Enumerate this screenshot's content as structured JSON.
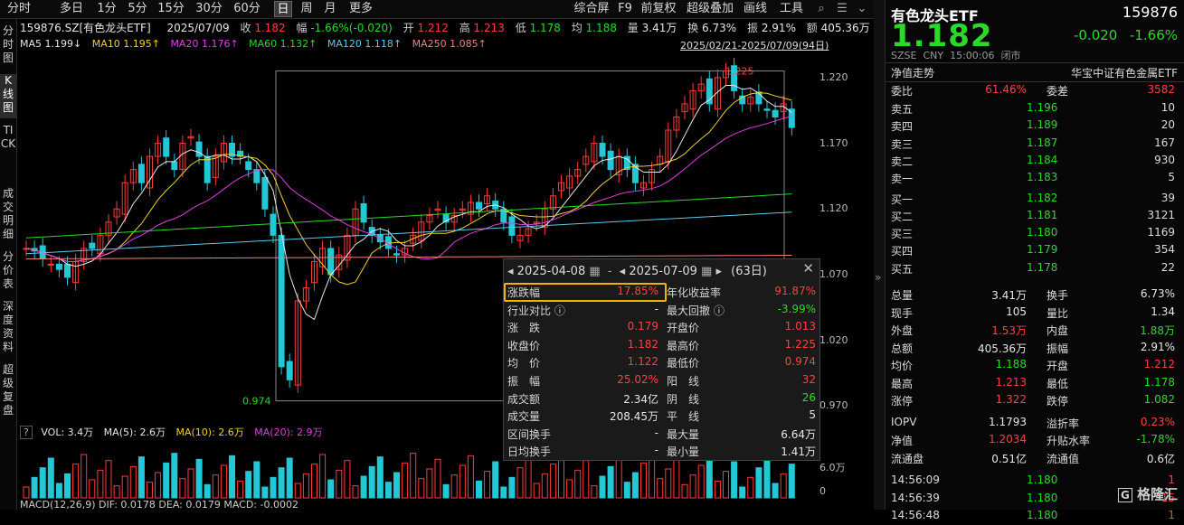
{
  "toolbar": {
    "periods": [
      "分时",
      "多日",
      "1分",
      "5分",
      "15分",
      "30分",
      "60分",
      "日",
      "周",
      "月",
      "更多"
    ],
    "active_period": "日",
    "tools": [
      "综合屏",
      "F9",
      "前复权",
      "超级叠加",
      "画线",
      "工具"
    ]
  },
  "sidenav": [
    "分时图",
    "K线图",
    "TICK",
    "成交明细",
    "分价表",
    "深度资料",
    "超级复盘"
  ],
  "sidenav_active": "K线图",
  "info": {
    "code": "159876.SZ[有色龙头ETF]",
    "date": "2025/07/09",
    "close_label": "收",
    "close": "1.182",
    "change_label": "幅",
    "change": "-1.66%(-0.020)",
    "open_label": "开",
    "open": "1.212",
    "high_label": "高",
    "high": "1.213",
    "low_label": "低",
    "low": "1.178",
    "avg_label": "均",
    "avg": "1.188",
    "vol_label": "量",
    "vol": "3.41万",
    "turnover_label": "换",
    "turnover": "6.73%",
    "amp_label": "振",
    "amp": "2.91%",
    "amount_label": "额",
    "amount": "405.36万"
  },
  "ma": {
    "ma5": "MA5 1.199↓",
    "ma10": "MA10 1.195↑",
    "ma20": "MA20 1.176↑",
    "ma60": "MA60 1.132↑",
    "ma120": "MA120 1.118↑",
    "ma250": "MA250 1.085↑",
    "range": "2025/02/21-2025/07/09(94日)"
  },
  "chart": {
    "yticks": [
      "1.220",
      "1.170",
      "1.120",
      "1.070",
      "1.020",
      "0.970"
    ],
    "high_mark": "1.225",
    "low_mark": "0.974",
    "vol_ticks": [
      "6.0万",
      "0"
    ]
  },
  "volume_bar": {
    "label": "VOL: 3.4万",
    "ma5": "MA(5): 2.6万",
    "ma10": "MA(10): 2.6万",
    "ma20": "MA(20): 2.9万"
  },
  "macd_bar": "MACD(12,26,9) DIF: 0.0178 DEA: 0.0179 MACD: -0.0002",
  "popup": {
    "start": "2025-04-08",
    "end": "2025-07-09",
    "days": "(63日)",
    "rows": [
      {
        "l": "涨跌幅",
        "v": "17.85%",
        "vc": "red",
        "l2": "年化收益率",
        "v2": "91.87%",
        "v2c": "red"
      },
      {
        "l": "行业对比 ⓘ",
        "v": "-",
        "vc": "white",
        "l2": "最大回撤 ⓘ",
        "v2": "-3.99%",
        "v2c": "green"
      },
      {
        "l": "涨　跌",
        "v": "0.179",
        "vc": "red",
        "l2": "开盘价",
        "v2": "1.013",
        "v2c": "red"
      },
      {
        "l": "收盘价",
        "v": "1.182",
        "vc": "red",
        "l2": "最高价",
        "v2": "1.225",
        "v2c": "red"
      },
      {
        "l": "均　价",
        "v": "1.122",
        "vc": "red",
        "l2": "最低价",
        "v2": "0.974",
        "v2c": "red"
      },
      {
        "l": "振　幅",
        "v": "25.02%",
        "vc": "red",
        "l2": "阳　线",
        "v2": "32",
        "v2c": "red"
      },
      {
        "l": "成交额",
        "v": "2.34亿",
        "vc": "white",
        "l2": "阴　线",
        "v2": "26",
        "v2c": "green"
      },
      {
        "l": "成交量",
        "v": "208.45万",
        "vc": "white",
        "l2": "平　线",
        "v2": "5",
        "v2c": "white"
      },
      {
        "l": "区间换手",
        "v": "-",
        "vc": "white",
        "l2": "最大量",
        "v2": "6.64万",
        "v2c": "white"
      },
      {
        "l": "日均换手",
        "v": "-",
        "vc": "white",
        "l2": "最小量",
        "v2": "1.41万",
        "v2c": "white"
      }
    ]
  },
  "quote": {
    "name": "有色龙头ETF",
    "code": "159876",
    "price": "1.182",
    "change": "-0.020",
    "pct": "-1.66%",
    "sub": "SZSE  CNY  15:00:06  闭市",
    "tab_left": "净值走势",
    "tab_right": "华宝中证有色金属ETF",
    "weibi_label": "委比",
    "weibi": "61.46%",
    "weicha_label": "委差",
    "weicha": "3582",
    "asks": [
      {
        "l": "卖五",
        "p": "1.196",
        "v": "10"
      },
      {
        "l": "卖四",
        "p": "1.189",
        "v": "20"
      },
      {
        "l": "卖三",
        "p": "1.187",
        "v": "167"
      },
      {
        "l": "卖二",
        "p": "1.184",
        "v": "930"
      },
      {
        "l": "卖一",
        "p": "1.183",
        "v": "5"
      }
    ],
    "bids": [
      {
        "l": "买一",
        "p": "1.182",
        "v": "39"
      },
      {
        "l": "买二",
        "p": "1.181",
        "v": "3121"
      },
      {
        "l": "买三",
        "p": "1.180",
        "v": "1169"
      },
      {
        "l": "买四",
        "p": "1.179",
        "v": "354"
      },
      {
        "l": "买五",
        "p": "1.178",
        "v": "22"
      }
    ],
    "stats": [
      {
        "l": "总量",
        "v": "3.41万",
        "vc": "white",
        "l2": "换手",
        "v2": "6.73%",
        "v2c": "white"
      },
      {
        "l": "现手",
        "v": "105",
        "vc": "white",
        "l2": "量比",
        "v2": "1.34",
        "v2c": "white"
      },
      {
        "l": "外盘",
        "v": "1.53万",
        "vc": "red",
        "l2": "内盘",
        "v2": "1.88万",
        "v2c": "green"
      },
      {
        "l": "总额",
        "v": "405.36万",
        "vc": "white",
        "l2": "振幅",
        "v2": "2.91%",
        "v2c": "white"
      },
      {
        "l": "均价",
        "v": "1.188",
        "vc": "green",
        "l2": "开盘",
        "v2": "1.212",
        "v2c": "red"
      },
      {
        "l": "最高",
        "v": "1.213",
        "vc": "red",
        "l2": "最低",
        "v2": "1.178",
        "v2c": "green"
      },
      {
        "l": "涨停",
        "v": "1.322",
        "vc": "red",
        "l2": "跌停",
        "v2": "1.082",
        "v2c": "green"
      }
    ],
    "iopv": [
      {
        "l": "IOPV",
        "v": "1.1793",
        "vc": "white",
        "l2": "溢折率",
        "v2": "0.23%",
        "v2c": "red"
      },
      {
        "l": "净值",
        "v": "1.2034",
        "vc": "red",
        "l2": "升贴水率",
        "v2": "-1.78%",
        "v2c": "green"
      },
      {
        "l": "流通盘",
        "v": "0.51亿",
        "vc": "white",
        "l2": "流通值",
        "v2": "0.6亿",
        "v2c": "white"
      }
    ],
    "ticks": [
      {
        "t": "14:56:09",
        "p": "1.180",
        "v": "1"
      },
      {
        "t": "14:56:39",
        "p": "1.180",
        "v": "15"
      },
      {
        "t": "14:56:48",
        "p": "1.180",
        "v": "1"
      }
    ]
  },
  "watermark": "格隆汇"
}
